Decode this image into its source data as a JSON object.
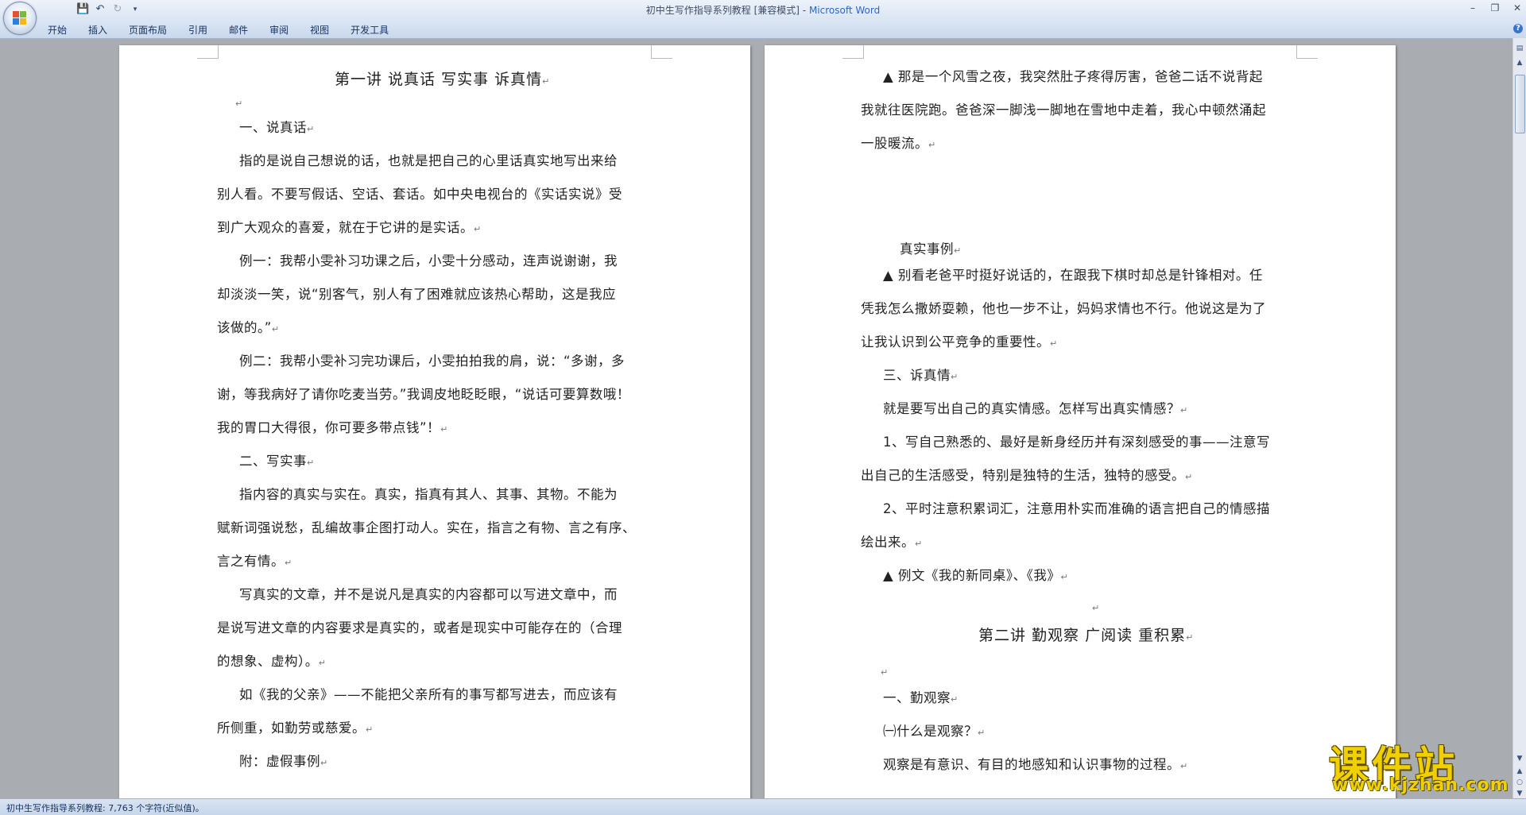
{
  "window": {
    "doc_name": "初中生写作指导系列教程 [兼容模式]",
    "title_sep": " - ",
    "app_name": "Microsoft Word"
  },
  "ribbon": {
    "tabs": [
      "开始",
      "插入",
      "页面布局",
      "引用",
      "邮件",
      "审阅",
      "视图",
      "开发工具"
    ]
  },
  "page_left": {
    "title": "第一讲  说真话  写实事  诉真情",
    "lines": [
      "一、说真话",
      "指的是说自己想说的话，也就是把自己的心里话真实地写出来给",
      "别人看。不要写假话、空话、套话。如中央电视台的《实话实说》受",
      "到广大观众的喜爱，就在于它讲的是实话。",
      "例一：我帮小雯补习功课之后，小雯十分感动，连声说谢谢，我",
      "却淡淡一笑，说“别客气，别人有了困难就应该热心帮助，这是我应",
      "该做的。”",
      "例二：我帮小雯补习完功课后，小雯拍拍我的肩，说：“多谢，多",
      "谢，等我病好了请你吃麦当劳。”我调皮地眨眨眼，“说话可要算数哦！",
      "我的胃口大得很，你可要多带点钱”！",
      "二、写实事",
      "指内容的真实与实在。真实，指真有其人、其事、其物。不能为",
      "赋新词强说愁，乱编故事企图打动人。实在，指言之有物、言之有序、",
      "言之有情。",
      "写真实的文章，并不是说凡是真实的内容都可以写进文章中，而",
      "是说写进文章的内容要求是真实的，或者是现实中可能存在的（合理",
      "的想象、虚构）。",
      "如《我的父亲》——不能把父亲所有的事写都写进去，而应该有",
      "所侧重，如勤劳或慈爱。",
      "附：虚假事例"
    ]
  },
  "page_right": {
    "lines_top": [
      "▲  那是一个风雪之夜，我突然肚子疼得厉害，爸爸二话不说背起",
      "我就往医院跑。爸爸深一脚浅一脚地在雪地中走着，我心中顿然涌起",
      "一股暖流。"
    ],
    "lines_mid": [
      "真实事例",
      "▲  别看老爸平时挺好说话的，在跟我下棋时却总是针锋相对。任",
      "凭我怎么撒娇耍赖，他也一步不让，妈妈求情也不行。他说这是为了",
      "让我认识到公平竞争的重要性。",
      "三、诉真情",
      "就是要写出自己的真实情感。怎样写出真实情感？",
      "1、写自己熟悉的、最好是新身经历并有深刻感受的事——注意写",
      "出自己的生活感受，特别是独特的生活，独特的感受。",
      "2、平时注意积累词汇，注意用朴实而准确的语言把自己的情感描",
      "绘出来。",
      "▲  例文《我的新同桌》、《我》"
    ],
    "title2": "第二讲  勤观察  广阅读  重积累",
    "lines_bottom": [
      "一、勤观察",
      "㈠什么是观察？",
      "观察是有意识、有目的地感知和认识事物的过程。"
    ]
  },
  "paragraph_mark": "↵",
  "status": {
    "text": "初中生写作指导系列教程: 7,763 个字符(近似值)。"
  },
  "watermark": {
    "cn": "课件站",
    "url": "www.kjzhan.com"
  }
}
